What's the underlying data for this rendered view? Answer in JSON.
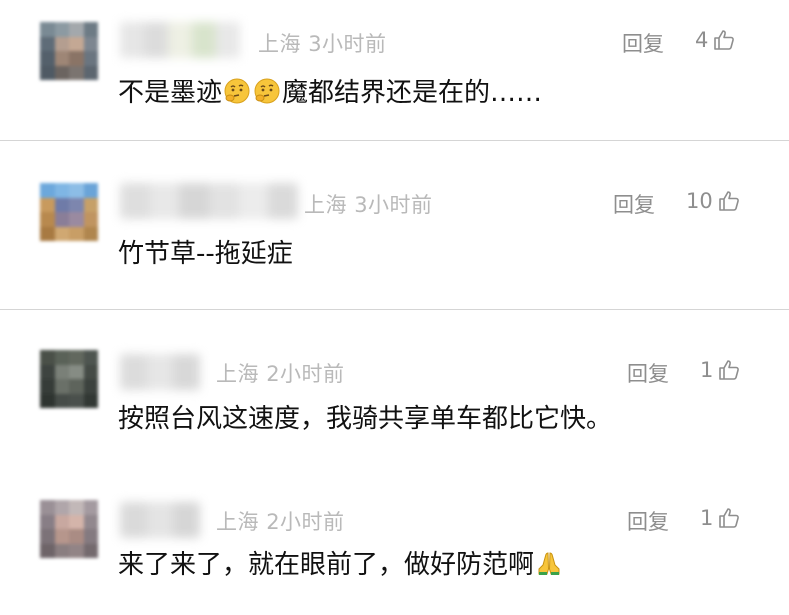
{
  "comments": [
    {
      "location": "上海",
      "time": "3小时前",
      "reply_label": "回复",
      "likes": "4",
      "text_parts": [
        "不是墨迹",
        "魔都结界还是在的……"
      ],
      "emojis": [
        "thinking-face-icon",
        "thinking-face-icon"
      ]
    },
    {
      "location": "上海",
      "time": "3小时前",
      "reply_label": "回复",
      "likes": "10",
      "text_parts": [
        "竹节草--拖延症"
      ]
    },
    {
      "location": "上海",
      "time": "2小时前",
      "reply_label": "回复",
      "likes": "1",
      "text_parts": [
        "按照台风这速度，我骑共享单车都比它快。"
      ]
    },
    {
      "location": "上海",
      "time": "2小时前",
      "reply_label": "回复",
      "likes": "1",
      "text_parts": [
        "来了来了，就在眼前了，做好防范啊"
      ],
      "emojis": [
        "folded-hands-icon"
      ]
    }
  ],
  "colors": {
    "meta": "#b9b9b9",
    "action": "#8e8e8e",
    "text": "#111111",
    "divider": "#d5d5d5"
  }
}
